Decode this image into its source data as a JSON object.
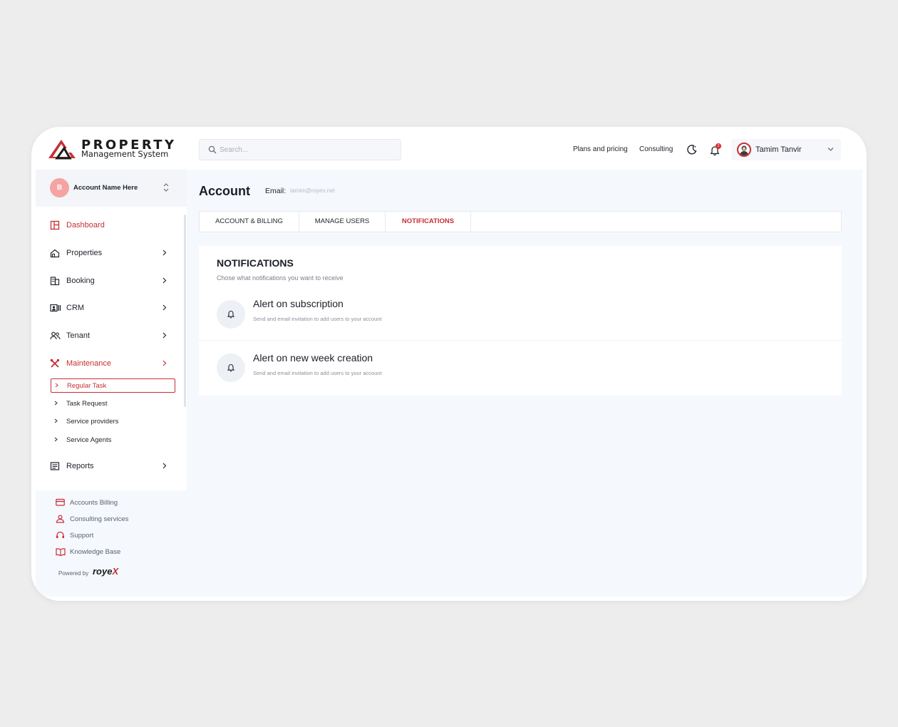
{
  "brand": {
    "title": "PROPERTY",
    "subtitle": "Management System",
    "accent": "#c62f35"
  },
  "search": {
    "placeholder": "Search..."
  },
  "topnav": {
    "plans_label": "Plans and pricing",
    "consulting_label": "Consulting",
    "notification_count": "2"
  },
  "user": {
    "name": "Tamim Tanvir"
  },
  "account": {
    "initial": "B",
    "name": "Account Name Here"
  },
  "sidebar": {
    "items": [
      {
        "label": "Dashboard",
        "icon": "dashboard-icon"
      },
      {
        "label": "Properties",
        "icon": "properties-icon"
      },
      {
        "label": "Booking",
        "icon": "building-icon"
      },
      {
        "label": "CRM",
        "icon": "crm-icon"
      },
      {
        "label": "Tenant",
        "icon": "tenant-icon"
      },
      {
        "label": "Maintenance",
        "icon": "tools-icon"
      },
      {
        "label": "Reports",
        "icon": "reports-icon"
      }
    ],
    "subitems": [
      {
        "label": "Regular Task"
      },
      {
        "label": "Task Request"
      },
      {
        "label": "Service providers"
      },
      {
        "label": "Service Agents"
      }
    ],
    "bottom": [
      {
        "label": "Accounts Billing",
        "icon": "card-icon"
      },
      {
        "label": "Consulting services",
        "icon": "person-icon"
      },
      {
        "label": "Support",
        "icon": "headset-icon"
      },
      {
        "label": "Knowledge Base",
        "icon": "book-icon"
      }
    ],
    "powered_by": "Powered by",
    "powered_brand_a": "roye",
    "powered_brand_b": "X"
  },
  "page": {
    "title": "Account",
    "email_label": "Email:",
    "email_value": "tamim@royex.net"
  },
  "tabs": [
    {
      "label": "ACCOUNT & BILLING"
    },
    {
      "label": "MANAGE USERS"
    },
    {
      "label": "NOTIFICATIONS"
    }
  ],
  "notifications": {
    "title": "NOTIFICATIONS",
    "subtitle": "Chose what notifications you want to receive",
    "items": [
      {
        "title": "Alert on subscription",
        "desc": "Send and email invitation to add users to your account"
      },
      {
        "title": "Alert on new week creation",
        "desc": "Send and email invitation to add users to your account"
      }
    ]
  }
}
